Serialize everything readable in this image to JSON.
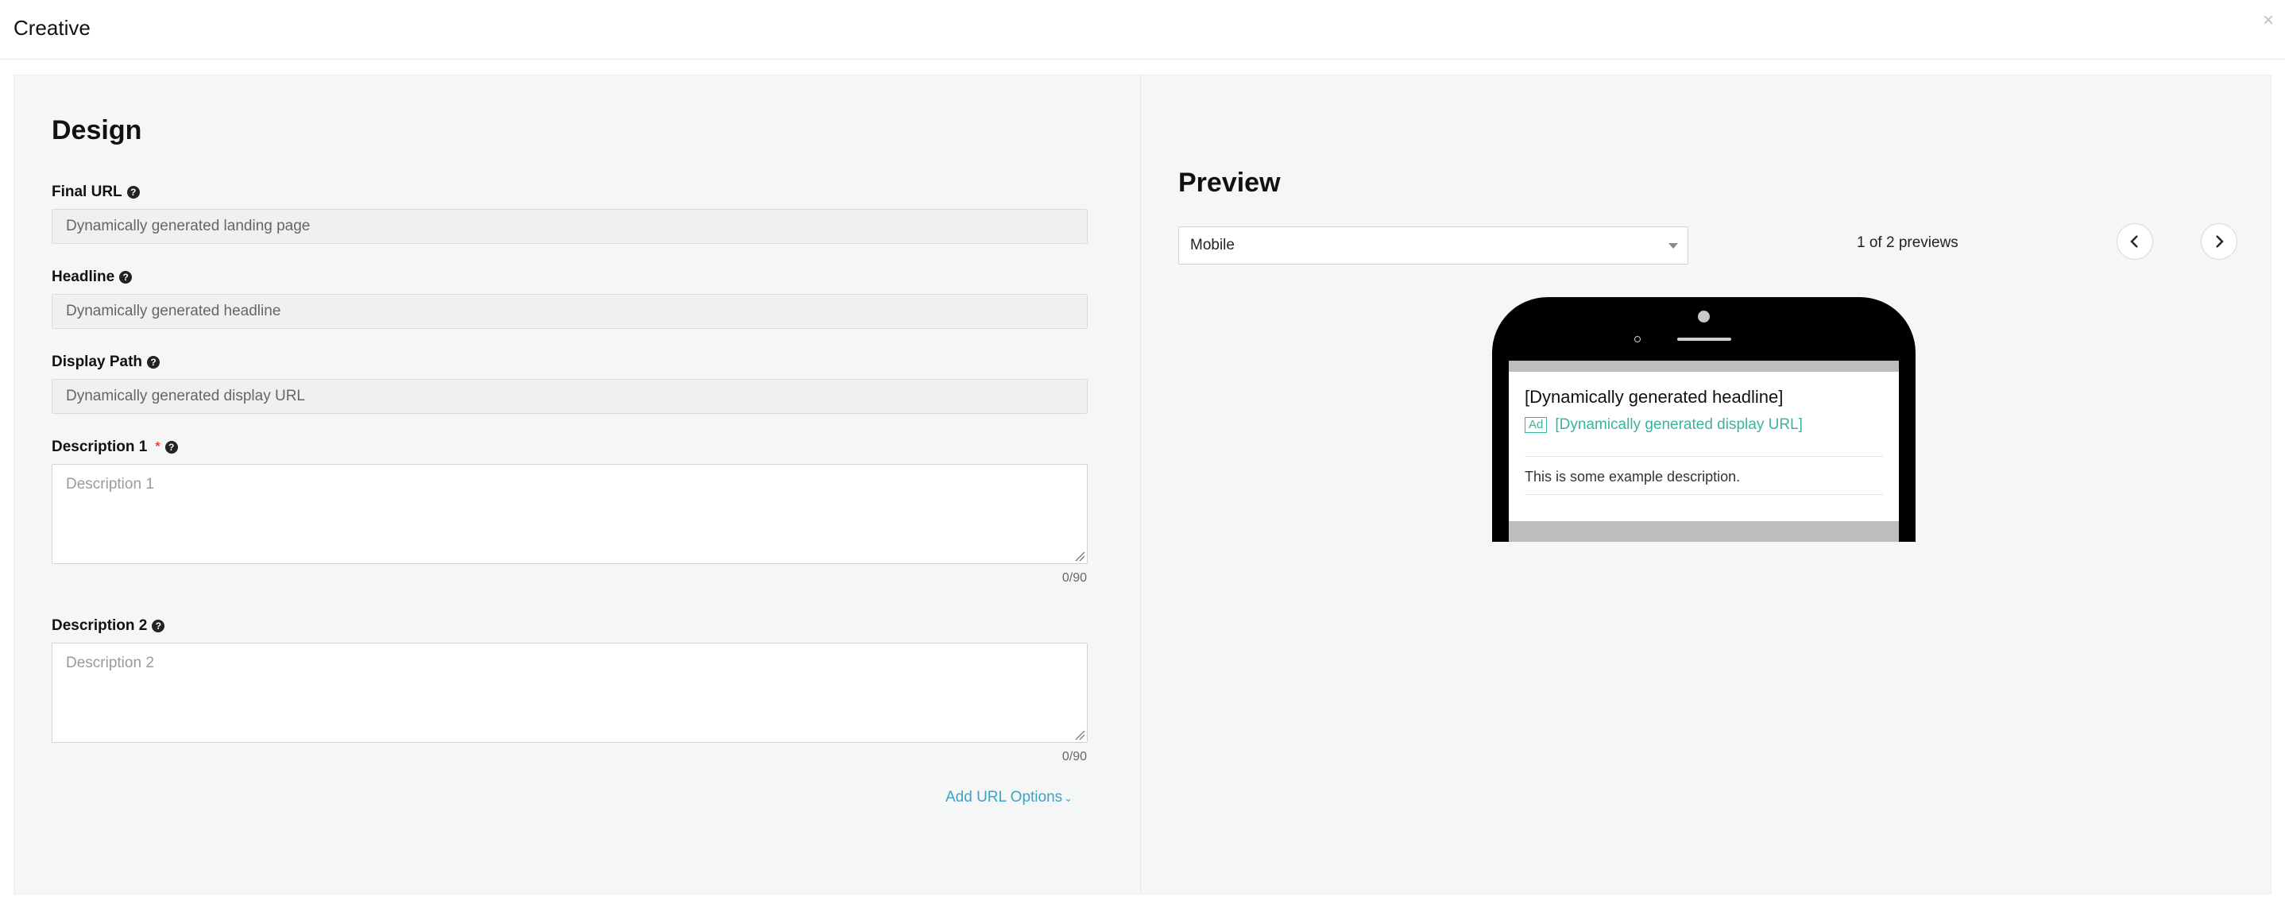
{
  "modal": {
    "title": "Creative",
    "close_icon": "×"
  },
  "design": {
    "heading": "Design",
    "final_url": {
      "label": "Final URL",
      "value": "Dynamically generated landing page"
    },
    "headline": {
      "label": "Headline",
      "value": "Dynamically generated headline"
    },
    "display_path": {
      "label": "Display Path",
      "value": "Dynamically generated display URL"
    },
    "description1": {
      "label": "Description 1",
      "required_marker": "*",
      "placeholder": "Description 1",
      "value": "",
      "counter": "0/90"
    },
    "description2": {
      "label": "Description 2",
      "placeholder": "Description 2",
      "value": "",
      "counter": "0/90"
    },
    "add_url_options": "Add URL Options"
  },
  "preview": {
    "heading": "Preview",
    "device_select": "Mobile",
    "count_text": "1 of 2 previews",
    "ad": {
      "headline": "[Dynamically generated headline]",
      "badge": "Ad",
      "display_url": "[Dynamically generated display URL]",
      "description": "This is some example description."
    }
  },
  "colors": {
    "link": "#3aa3c7",
    "ad_green": "#3ab39a",
    "required": "#e0463c"
  },
  "icons": {
    "help": "question-circle-icon",
    "close": "close-icon",
    "prev": "chevron-left-icon",
    "next": "chevron-right-icon",
    "dropdown": "caret-down-icon"
  }
}
